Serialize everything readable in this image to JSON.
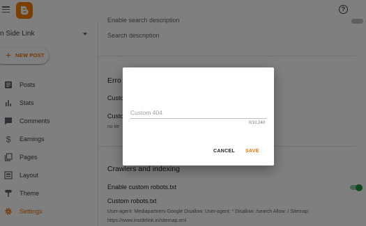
{
  "header": {
    "help_icon": "help-circle-icon",
    "help_glyph": "?"
  },
  "sidebar": {
    "blog_name": "n Side Link",
    "new_post_label": "NEW POST",
    "new_post_icon": "+",
    "items": [
      {
        "label": "Posts",
        "icon": "posts-icon"
      },
      {
        "label": "Stats",
        "icon": "stats-icon"
      },
      {
        "label": "Comments",
        "icon": "comments-icon"
      },
      {
        "label": "Earnings",
        "icon": "dollar-icon"
      },
      {
        "label": "Pages",
        "icon": "pages-icon"
      },
      {
        "label": "Layout",
        "icon": "layout-icon"
      },
      {
        "label": "Theme",
        "icon": "theme-icon"
      },
      {
        "label": "Settings",
        "icon": "gear-icon",
        "active": true
      }
    ]
  },
  "main": {
    "search_desc_partial": "Enable search description",
    "search_description": "Search description",
    "errors_title_partial": "Erro",
    "custom_row_1_partial": "Custo",
    "custom_row_2_partial": "Custo",
    "no_items_partial": "no ite",
    "crawlers_title": "Crawlers and indexing",
    "robots_toggle_label": "Enable custom robots.txt",
    "robots_toggle_on": true,
    "robots_label": "Custom robots.txt",
    "robots_value_line1": "User-agent: Mediapartners-Google Disallow: User-agent: * Disallow: /search Allow: / Sitemap:",
    "robots_value_line2": "https://www.insidelink.in/sitemap.xml"
  },
  "dialog": {
    "input_placeholder": "Custom 404",
    "input_value": "",
    "counter": "0/10,240",
    "cancel_label": "CANCEL",
    "save_label": "SAVE"
  },
  "colors": {
    "accent": "#e8710a",
    "logo": "#f57c00",
    "toggle": "#1e8e3e"
  }
}
